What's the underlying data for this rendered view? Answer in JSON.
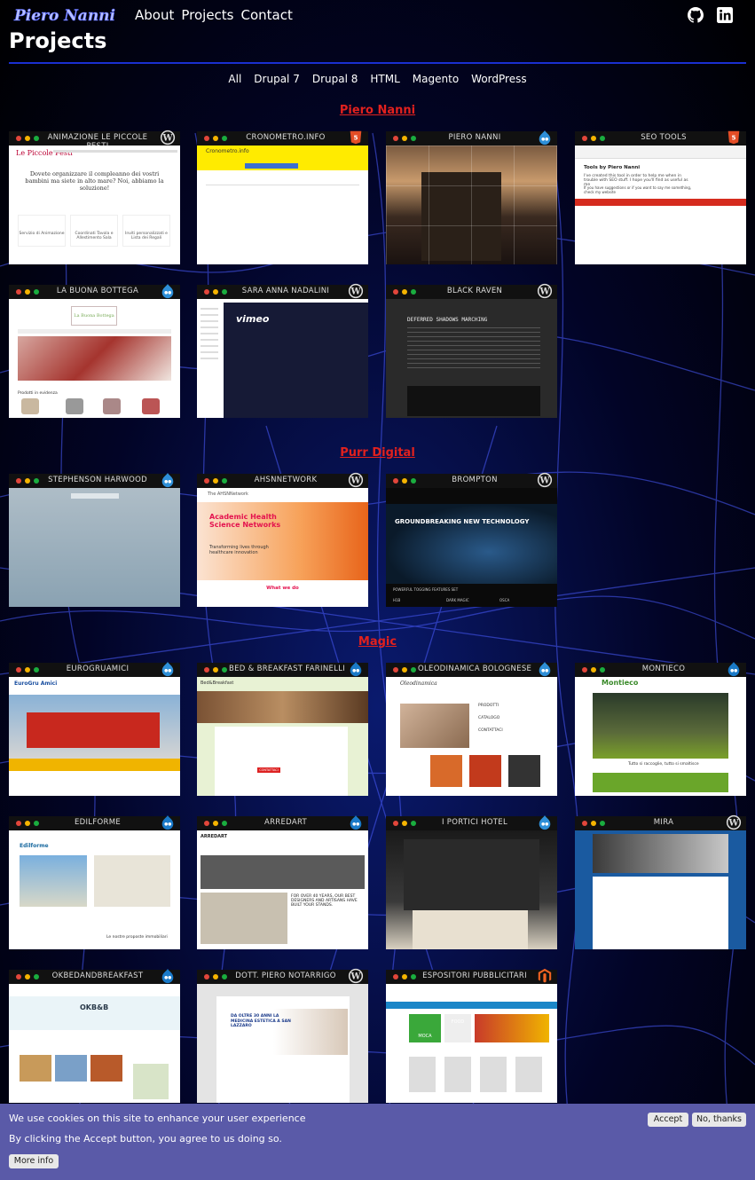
{
  "header": {
    "logo_text": "Piero Nanni",
    "nav": [
      "About",
      "Projects",
      "Contact"
    ],
    "social": [
      "github-icon",
      "linkedin-icon"
    ]
  },
  "page_title": "Projects",
  "filters": [
    "All",
    "Drupal 7",
    "Drupal 8",
    "HTML",
    "Magento",
    "WordPress"
  ],
  "sections": [
    {
      "title": "Piero Nanni",
      "cards": [
        {
          "title": "ANIMAZIONE LE PICCOLE PESTI",
          "tech": "wordpress"
        },
        {
          "title": "CRONOMETRO.INFO",
          "tech": "html5"
        },
        {
          "title": "PIERO NANNI",
          "tech": "drupal"
        },
        {
          "title": "SEO TOOLS",
          "tech": "html5"
        },
        {
          "title": "LA BUONA BOTTEGA",
          "tech": "drupal"
        },
        {
          "title": "SARA ANNA NADALINI",
          "tech": "wordpress"
        },
        {
          "title": "BLACK RAVEN",
          "tech": "wordpress"
        }
      ]
    },
    {
      "title": "Purr Digital",
      "cards": [
        {
          "title": "STEPHENSON HARWOOD",
          "tech": "drupal"
        },
        {
          "title": "AHSNNETWORK",
          "tech": "wordpress"
        },
        {
          "title": "BROMPTON",
          "tech": "wordpress"
        }
      ]
    },
    {
      "title": "Magic",
      "cards": [
        {
          "title": "EUROGRUAMICI",
          "tech": "drupal"
        },
        {
          "title": "BED & BREAKFAST FARINELLI",
          "tech": "drupal8"
        },
        {
          "title": "OLEODINAMICA BOLOGNESE",
          "tech": "drupal"
        },
        {
          "title": "MONTIECO",
          "tech": "drupal8"
        },
        {
          "title": "EDILFORME",
          "tech": "drupal8"
        },
        {
          "title": "ARREDART",
          "tech": "drupal8"
        },
        {
          "title": "I PORTICI HOTEL",
          "tech": "drupal"
        },
        {
          "title": "MIRA",
          "tech": "wordpress"
        },
        {
          "title": "OKBEDANDBREAKFAST",
          "tech": "drupal8"
        },
        {
          "title": "DOTT. PIERO NOTARRIGO",
          "tech": "wordpress"
        },
        {
          "title": "ESPOSITORI PUBBLICITARI",
          "tech": "magento"
        }
      ]
    }
  ],
  "shots": {
    "piccole_pesti": {
      "brand": "Le Piccole Pesti",
      "heading": "Dovete organizzare il compleanno dei vostri bambini ma siete in alto mare? Noi, abbiamo la soluzione!",
      "boxes": [
        "Servizio di Animazione",
        "Coordinati Tavola e Allestimento Sala",
        "Inviti personalizzati e Lista dei Regali"
      ]
    },
    "cronometro": {
      "brand": "Cronometro.info"
    },
    "seo": {
      "heading": "Tools by Piero Nanni",
      "text": "I've created this tool in order to help me when in trouble with SEO stuff. I hope you'll find as useful as me",
      "text2": "If you have suggestions or if you want to say me something, check my website"
    },
    "buona": {
      "brand": "La Buona Bottega",
      "caption": "Prodotti in evidenza"
    },
    "sara": {
      "brand": "vimeo"
    },
    "raven": {
      "heading": "DEFERRED SHADOWS MARCHING"
    },
    "ahsn": {
      "heading": "Academic Health Science Networks",
      "sub": "Transforming lives through healthcare innovation",
      "what": "What we do",
      "brand": "The AHSNNetwork"
    },
    "brompton": {
      "heading": "GROUNDBREAKING NEW TECHNOLOGY",
      "f1": "H1B",
      "f2": "DARK MAGIC",
      "f3": "OSCA",
      "features": "POWERFUL TOGGING FEATURES SET"
    },
    "eurogru": {
      "brand": "EuroGru Amici"
    },
    "farinelli": {
      "brand": "Bed&Breakfast",
      "cta": "CONTATTACI"
    },
    "oleo": {
      "brand": "Oleodinamica",
      "items": [
        "PRODOTTI",
        "CATALOGO",
        "CONTATTACI"
      ]
    },
    "montieco": {
      "brand": "Montieco",
      "caption": "Tutto si raccoglie, tutto si smaltisce"
    },
    "edilforme": {
      "brand": "Edilforme",
      "caption": "Le nostre proposte immobiliari"
    },
    "arredart": {
      "brand": "ARREDART",
      "heading": "FOR OVER 40 YEARS, OUR BEST DESIGNERS AND ARTISANS HAVE BUILT YOUR STANDS."
    },
    "okbb": {
      "brand": "OKB&B"
    },
    "notarrigo": {
      "heading": "DA OLTRE 30 ANNI LA MEDICINA ESTETICA A SAN LAZZARO"
    },
    "espositori": {
      "brand": "MOCA",
      "food": "FOOD"
    }
  },
  "cookie": {
    "line1": "We use cookies on this site to enhance your user experience",
    "line2": "By clicking the Accept button, you agree to us doing so.",
    "accept": "Accept",
    "decline": "No, thanks",
    "more": "More info"
  },
  "colors": {
    "accent": "#e1211e",
    "rule": "#1a2fd0",
    "cookie_bg": "#5a5aa8"
  }
}
